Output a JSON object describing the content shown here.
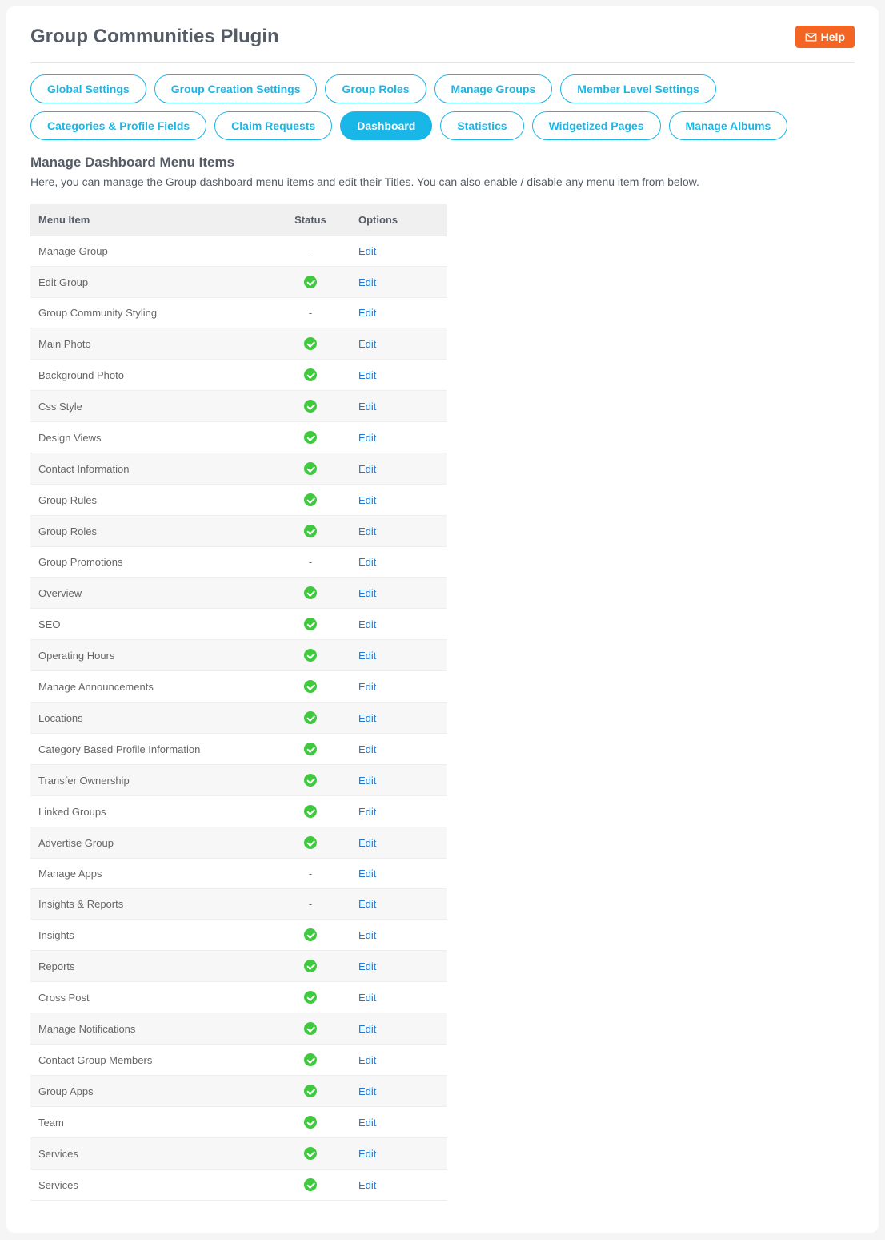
{
  "header": {
    "title": "Group Communities Plugin",
    "help_label": "Help"
  },
  "tabs": [
    {
      "label": "Global Settings",
      "active": false
    },
    {
      "label": "Group Creation Settings",
      "active": false
    },
    {
      "label": "Group Roles",
      "active": false
    },
    {
      "label": "Manage Groups",
      "active": false
    },
    {
      "label": "Member Level Settings",
      "active": false
    },
    {
      "label": "Categories & Profile Fields",
      "active": false
    },
    {
      "label": "Claim Requests",
      "active": false
    },
    {
      "label": "Dashboard",
      "active": true
    },
    {
      "label": "Statistics",
      "active": false
    },
    {
      "label": "Widgetized Pages",
      "active": false
    },
    {
      "label": "Manage Albums",
      "active": false
    }
  ],
  "section": {
    "title": "Manage Dashboard Menu Items",
    "description": "Here, you can manage the Group dashboard menu items and edit their Titles. You can also enable / disable any menu item from below."
  },
  "table": {
    "headers": [
      "Menu Item",
      "Status",
      "Options"
    ],
    "edit_label": "Edit",
    "rows": [
      {
        "name": "Manage Group",
        "status": "dash"
      },
      {
        "name": "Edit Group",
        "status": "check"
      },
      {
        "name": "Group Community Styling",
        "status": "dash"
      },
      {
        "name": "Main Photo",
        "status": "check"
      },
      {
        "name": "Background Photo",
        "status": "check"
      },
      {
        "name": "Css Style",
        "status": "check"
      },
      {
        "name": "Design Views",
        "status": "check"
      },
      {
        "name": "Contact Information",
        "status": "check"
      },
      {
        "name": "Group Rules",
        "status": "check"
      },
      {
        "name": "Group Roles",
        "status": "check"
      },
      {
        "name": "Group Promotions",
        "status": "dash"
      },
      {
        "name": "Overview",
        "status": "check"
      },
      {
        "name": "SEO",
        "status": "check"
      },
      {
        "name": "Operating Hours",
        "status": "check"
      },
      {
        "name": "Manage Announcements",
        "status": "check"
      },
      {
        "name": "Locations",
        "status": "check"
      },
      {
        "name": "Category Based Profile Information",
        "status": "check"
      },
      {
        "name": "Transfer Ownership",
        "status": "check"
      },
      {
        "name": "Linked Groups",
        "status": "check"
      },
      {
        "name": "Advertise Group",
        "status": "check"
      },
      {
        "name": "Manage Apps",
        "status": "dash"
      },
      {
        "name": "Insights & Reports",
        "status": "dash"
      },
      {
        "name": "Insights",
        "status": "check"
      },
      {
        "name": "Reports",
        "status": "check"
      },
      {
        "name": "Cross Post",
        "status": "check"
      },
      {
        "name": "Manage Notifications",
        "status": "check"
      },
      {
        "name": "Contact Group Members",
        "status": "check"
      },
      {
        "name": "Group Apps",
        "status": "check"
      },
      {
        "name": "Team",
        "status": "check"
      },
      {
        "name": "Services",
        "status": "check"
      },
      {
        "name": "Services",
        "status": "check"
      }
    ]
  }
}
